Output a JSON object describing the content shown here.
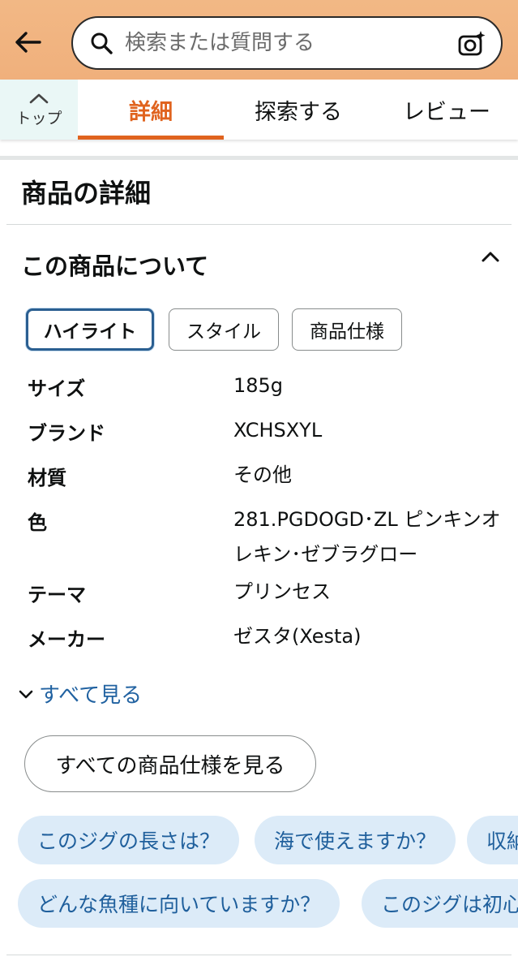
{
  "search": {
    "placeholder": "検索または質問する"
  },
  "nav": {
    "top_label": "トップ",
    "tabs": [
      {
        "label": "詳細",
        "active": true
      },
      {
        "label": "探索する",
        "active": false
      },
      {
        "label": "レビュー",
        "active": false
      }
    ]
  },
  "section": {
    "title": "商品の詳細",
    "subtitle": "この商品について"
  },
  "chips": [
    {
      "label": "ハイライト",
      "selected": true
    },
    {
      "label": "スタイル",
      "selected": false
    },
    {
      "label": "商品仕様",
      "selected": false
    }
  ],
  "specs": [
    {
      "key": "サイズ",
      "value": "185g"
    },
    {
      "key": "ブランド",
      "value": "XCHSXYL"
    },
    {
      "key": "材質",
      "value": "その他"
    },
    {
      "key": "色",
      "value": "281.PGDOGD･ZL ピンキンオレキン･ゼブラグロー"
    },
    {
      "key": "テーマ",
      "value": "プリンセス"
    },
    {
      "key": "メーカー",
      "value": "ゼスタ(Xesta)"
    }
  ],
  "see_all_label": "すべて見る",
  "all_specs_button": "すべての商品仕様を見る",
  "questions": [
    "このジグの長さは？",
    "海で使えますか？",
    "収納",
    "どんな魚種に向いていますか？",
    "このジグは初心"
  ],
  "colors": {
    "accent": "#e0631e",
    "header_bg": "#f2b885",
    "link": "#2162a1",
    "chip_bg": "#dcebf8"
  }
}
